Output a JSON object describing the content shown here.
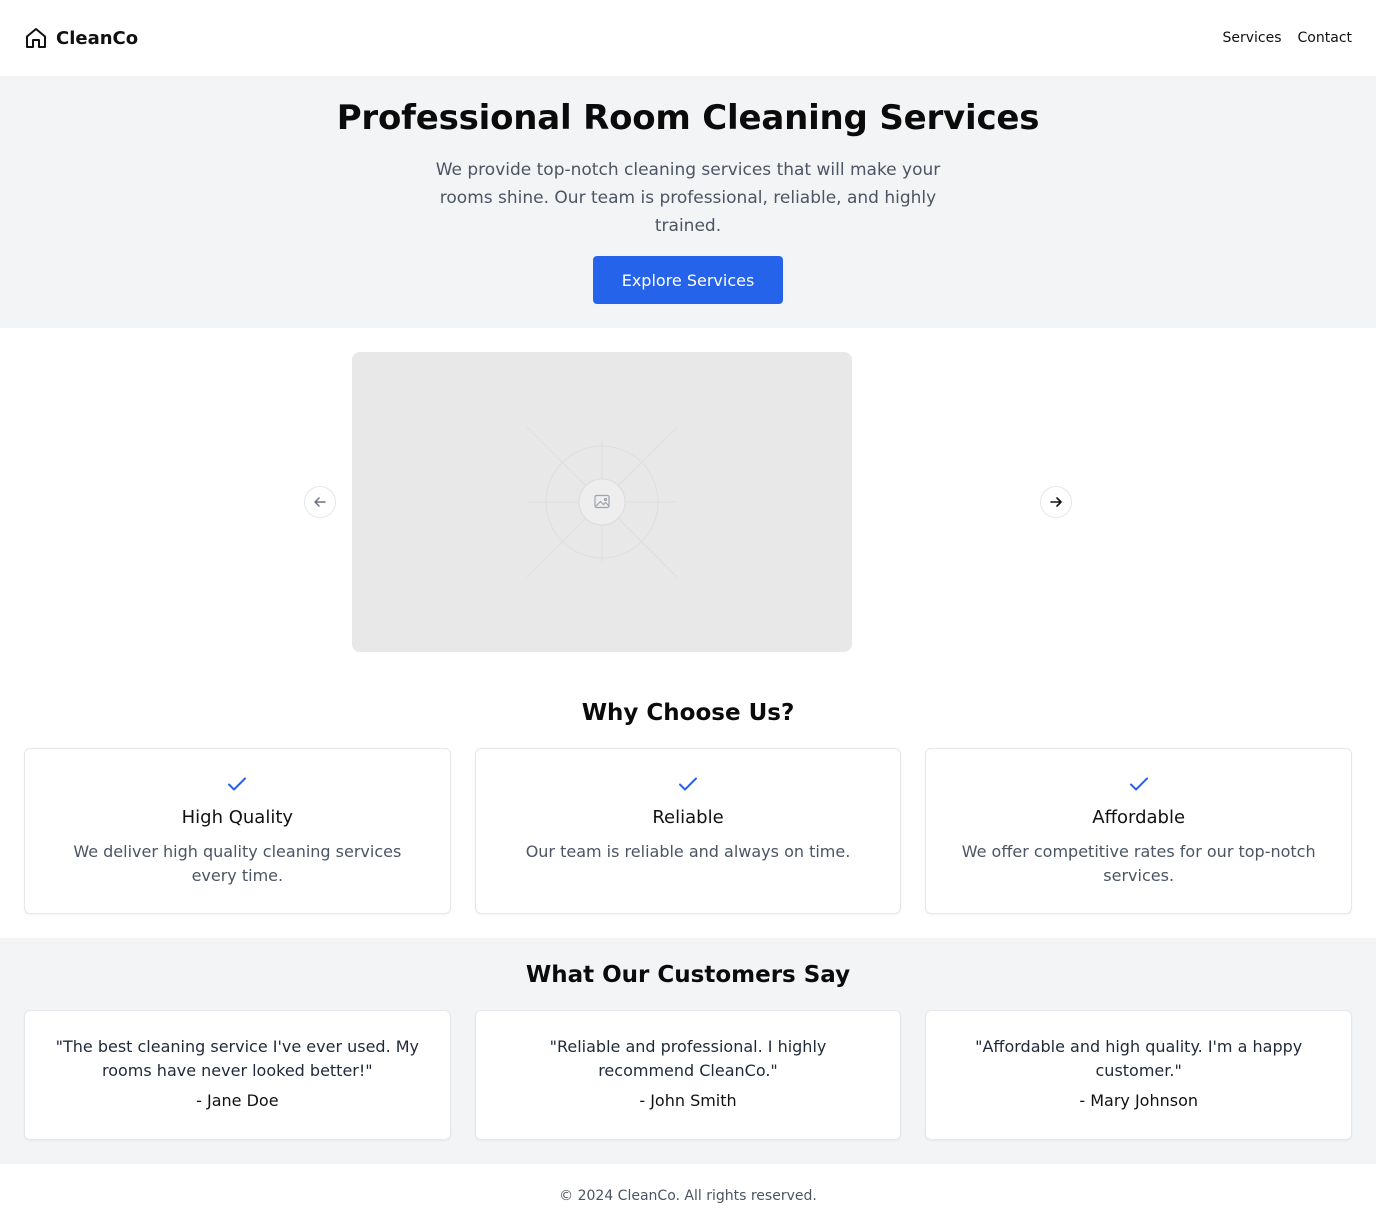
{
  "header": {
    "brand": "CleanCo",
    "nav": [
      "Services",
      "Contact"
    ]
  },
  "hero": {
    "title": "Professional Room Cleaning Services",
    "text": "We provide top-notch cleaning services that will make your rooms shine. Our team is professional, reliable, and highly trained.",
    "cta": "Explore Services"
  },
  "features": {
    "title": "Why Choose Us?",
    "items": [
      {
        "title": "High Quality",
        "text": "We deliver high quality cleaning services every time."
      },
      {
        "title": "Reliable",
        "text": "Our team is reliable and always on time."
      },
      {
        "title": "Affordable",
        "text": "We offer competitive rates for our top-notch services."
      }
    ]
  },
  "testimonials": {
    "title": "What Our Customers Say",
    "items": [
      {
        "quote": "\"The best cleaning service I've ever used. My rooms have never looked better!\"",
        "author": "- Jane Doe"
      },
      {
        "quote": "\"Reliable and professional. I highly recommend CleanCo.\"",
        "author": "- John Smith"
      },
      {
        "quote": "\"Affordable and high quality. I'm a happy customer.\"",
        "author": "- Mary Johnson"
      }
    ]
  },
  "footer": {
    "text": "© 2024 CleanCo. All rights reserved."
  },
  "icons": {
    "brand": "home-icon",
    "carousel_prev": "arrow-left-icon",
    "carousel_next": "arrow-right-icon",
    "slide_placeholder": "image-placeholder-icon",
    "feature": "check-icon"
  },
  "colors": {
    "accent": "#2563eb",
    "hero_bg": "#f3f4f6",
    "check": "#2563eb"
  }
}
